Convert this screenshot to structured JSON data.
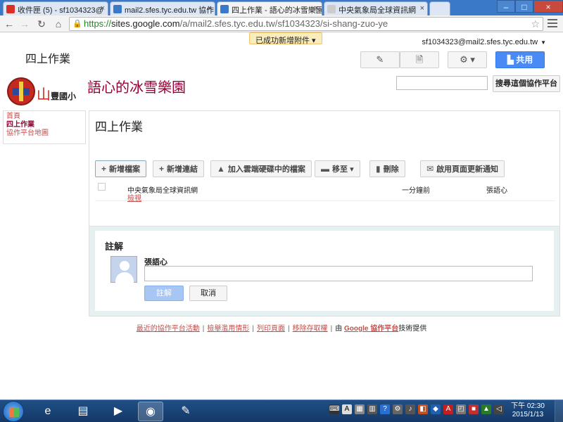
{
  "browser": {
    "tabs": [
      {
        "label": "收件匣 (5) - sf1034323@",
        "favicon_color": "#d93025"
      },
      {
        "label": "mail2.sfes.tyc.edu.tw 協作",
        "favicon_color": "#3a78c8"
      },
      {
        "label": "四上作業 - 語心的冰雪樂園",
        "favicon_color": "#3a78c8"
      },
      {
        "label": "中央氣象局全球資訊網",
        "favicon_color": "#cccccc"
      }
    ],
    "address": {
      "scheme": "https://",
      "host": "sites.google.com",
      "path": "/a/mail2.sfes.tyc.edu.tw/sf1034323/si-shang-zuo-ye"
    }
  },
  "notification": "已成功新增附件 ▾",
  "user": {
    "email": "sf1034323@mail2.sfes.tyc.edu.tw"
  },
  "header": {
    "page_title": "四上作業",
    "share_label": "共用",
    "site_name": "語心的冰雪樂園",
    "logo_text": "山",
    "logo_subtext": "豐國小",
    "search_button": "搜尋這個協作平台"
  },
  "sidebar": {
    "items": [
      {
        "label": "首頁"
      },
      {
        "label": "四上作業"
      },
      {
        "label": "協作平台地圖"
      }
    ]
  },
  "main": {
    "title": "四上作業",
    "actions": [
      {
        "label": "新增檔案",
        "icon": "+"
      },
      {
        "label": "新增連結",
        "icon": "+"
      },
      {
        "label": "加入雲端硬碟中的檔案",
        "icon": "▲"
      },
      {
        "label": "移至",
        "icon": "▬"
      },
      {
        "label": "刪除",
        "icon": "▮"
      },
      {
        "label": "啟用頁面更新通知",
        "icon": "✉"
      }
    ],
    "files": [
      {
        "name": "中央氣象局全球資訊網",
        "link": "檢視",
        "time": "一分鐘前",
        "user": "張語心"
      }
    ]
  },
  "comments": {
    "title": "註解",
    "user": "張語心",
    "submit": "註解",
    "cancel": "取消"
  },
  "footer": {
    "links": [
      "最近的協作平台活動",
      "檢舉濫用情形",
      "列印頁面",
      "移除存取權"
    ],
    "powered_prefix": "由",
    "powered_link": "Google 協作平台",
    "powered_suffix": "技術提供"
  },
  "taskbar": {
    "time": "下午 02:30",
    "date": "2015/1/13"
  }
}
